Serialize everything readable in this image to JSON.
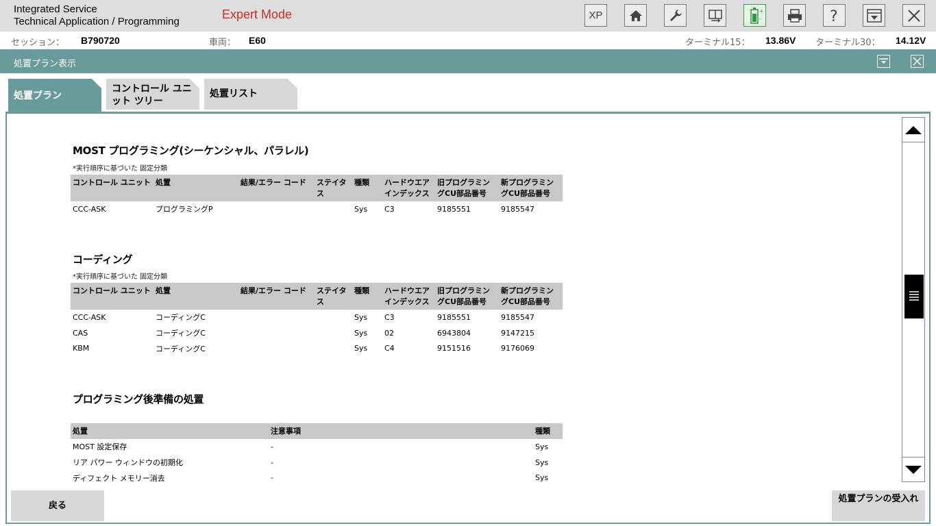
{
  "app": {
    "title_line1": "Integrated Service",
    "title_line2": "Technical Application / Programming",
    "mode": "Expert Mode"
  },
  "toolbar": {
    "xp_label": "XP",
    "icons": [
      "xp-icon",
      "home-icon",
      "wrench-icon",
      "swap-icon",
      "battery-icon",
      "printer-icon",
      "help-icon",
      "download-icon",
      "close-icon"
    ]
  },
  "info": {
    "session_label": "セッション：",
    "session_value": "B790720",
    "vehicle_label": "車両：",
    "vehicle_value": "E60",
    "terminal15_label": "ターミナル15：",
    "terminal15_value": "13.86V",
    "terminal30_label": "ターミナル30：",
    "terminal30_value": "14.12V"
  },
  "section": {
    "title": "処置プラン表示"
  },
  "tabs": [
    {
      "label": "処置プラン",
      "active": true
    },
    {
      "label": "コントロール ユニット ツリー",
      "active": false
    },
    {
      "label": "処置リスト",
      "active": false
    }
  ],
  "most": {
    "heading": "MOST プログラミング(シーケンシャル、パラレル)",
    "note": "*実行順序に基づいた 固定分類",
    "headers": [
      "コントロール ユニット",
      "処置",
      "結果/エラー コード",
      "ステイタス",
      "種類",
      "ハードウエア インデックス",
      "旧プログラミングCU部品番号",
      "新プログラミングCU部品番号"
    ],
    "rows": [
      [
        "CCC-ASK",
        "プログラミングP",
        "",
        "",
        "Sys",
        "C3",
        "9185551",
        "9185547"
      ]
    ]
  },
  "coding": {
    "heading": "コーディング",
    "note": "*実行順序に基づいた 固定分類",
    "headers": [
      "コントロール ユニット",
      "処置",
      "結果/エラー コード",
      "ステイタス",
      "種類",
      "ハードウエア インデックス",
      "旧プログラミングCU部品番号",
      "新プログラミングCU部品番号"
    ],
    "rows": [
      [
        "CCC-ASK",
        "コーディングC",
        "",
        "",
        "Sys",
        "C3",
        "9185551",
        "9185547"
      ],
      [
        "CAS",
        "コーディングC",
        "",
        "",
        "Sys",
        "02",
        "6943804",
        "9147215"
      ],
      [
        "KBM",
        "コーディングC",
        "",
        "",
        "Sys",
        "C4",
        "9151516",
        "9176069"
      ]
    ]
  },
  "post": {
    "heading": "プログラミング後準備の処置",
    "headers": [
      "処置",
      "注意事項",
      "種類"
    ],
    "rows": [
      [
        "MOST 設定保存",
        "-",
        "Sys"
      ],
      [
        "リア パワー ウィンドウの初期化",
        "-",
        "Sys"
      ],
      [
        "ディフェクト メモリー消去",
        "-",
        "Sys"
      ]
    ]
  },
  "buttons": {
    "back": "戻る",
    "accept": "処置プランの受入れ"
  }
}
